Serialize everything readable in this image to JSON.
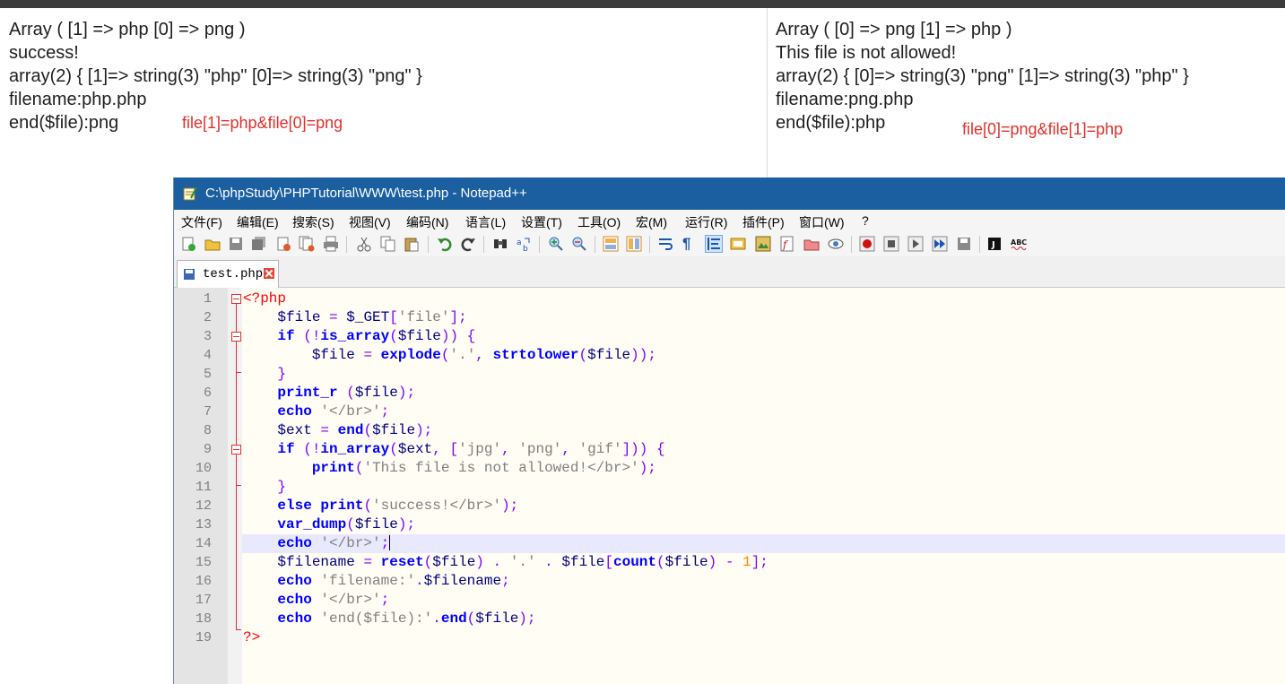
{
  "output_left": {
    "lines": [
      "Array ( [1] => php [0] => png )",
      "success!",
      "array(2) { [1]=> string(3) \"php\" [0]=> string(3) \"png\" }",
      "filename:php.php",
      "end($file):png"
    ],
    "note": "file[1]=php&file[0]=png"
  },
  "output_right": {
    "lines": [
      "Array ( [0] => png [1] => php )",
      "This file is not allowed!",
      "array(2) { [0]=> string(3) \"png\" [1]=> string(3) \"php\" }",
      "filename:png.php",
      "end($file):php"
    ],
    "note": "file[0]=png&file[1]=php"
  },
  "window": {
    "title": "C:\\phpStudy\\PHPTutorial\\WWW\\test.php - Notepad++",
    "menu": [
      "文件(F)",
      "编辑(E)",
      "搜索(S)",
      "视图(V)",
      "编码(N)",
      "语言(L)",
      "设置(T)",
      "工具(O)",
      "宏(M)",
      "运行(R)",
      "插件(P)",
      "窗口(W)",
      "?"
    ],
    "tab_label": "test.php",
    "current_line": 14
  },
  "code": {
    "line_numbers": [
      "1",
      "2",
      "3",
      "4",
      "5",
      "6",
      "7",
      "8",
      "9",
      "10",
      "11",
      "12",
      "13",
      "14",
      "15",
      "16",
      "17",
      "18",
      "19"
    ],
    "lines": [
      "<?php",
      "    $file = $_GET['file'];",
      "    if (!is_array($file)) {",
      "        $file = explode('.', strtolower($file));",
      "    }",
      "    print_r ($file);",
      "    echo '</br>';",
      "    $ext = end($file);",
      "    if (!in_array($ext, ['jpg', 'png', 'gif'])) {",
      "        print('This file is not allowed!</br>');",
      "    }",
      "    else print('success!</br>');",
      "    var_dump($file);",
      "    echo '</br>';",
      "    $filename = reset($file) . '.' . $file[count($file) - 1];",
      "    echo 'filename:'.$filename;",
      "    echo '</br>';",
      "    echo 'end($file):'.end($file);",
      "?>"
    ]
  },
  "colors": {
    "keyword": "#0000ff",
    "variable": "#000080",
    "string": "#808080",
    "operator": "#8000ff",
    "php_tag": "#ff0000",
    "title_bar": "#1b5fa0",
    "note_red": "#e0312b"
  }
}
